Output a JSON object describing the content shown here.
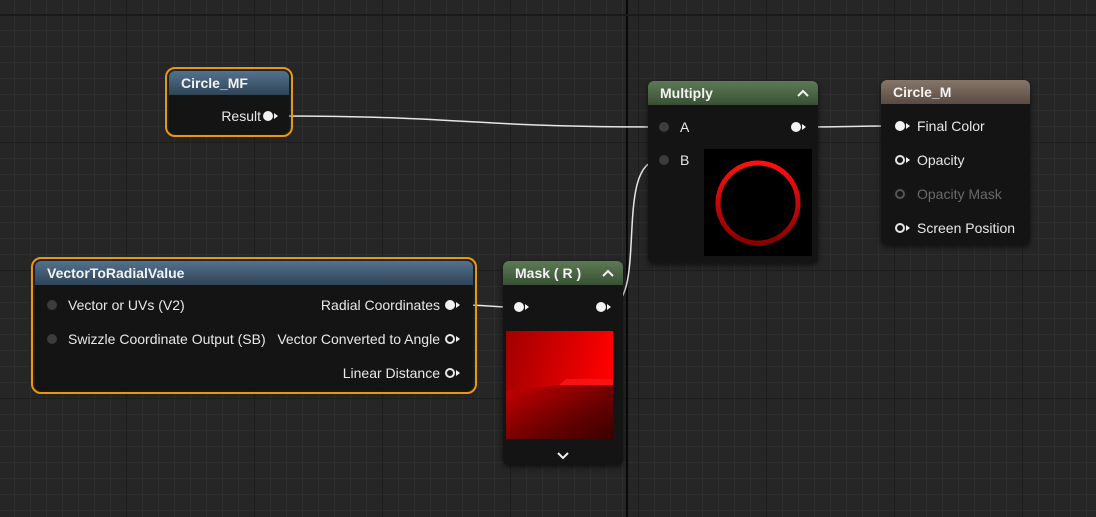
{
  "nodes": {
    "circle_mf": {
      "title": "Circle_MF",
      "output": "Result"
    },
    "vector_radial": {
      "title": "VectorToRadialValue",
      "inputs": [
        "Vector or UVs (V2)",
        "Swizzle Coordinate Output (SB)"
      ],
      "outputs": [
        "Radial Coordinates",
        "Vector Converted to Angle",
        "Linear Distance"
      ]
    },
    "mask": {
      "title": "Mask ( R )"
    },
    "multiply": {
      "title": "Multiply",
      "inputs": [
        "A",
        "B"
      ]
    },
    "circle_m": {
      "title": "Circle_M",
      "inputs": [
        "Final Color",
        "Opacity",
        "Opacity Mask",
        "Screen Position"
      ]
    }
  },
  "colors": {
    "selection": "#e8980f",
    "wire": "#e6e6e6",
    "preview_red": "#e00000"
  },
  "icons": {
    "collapse": "chevron-up-icon",
    "expand": "chevron-down-icon"
  }
}
